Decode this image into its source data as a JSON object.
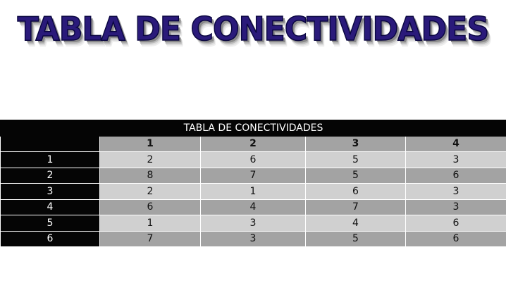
{
  "heading": "TABLA DE CONECTIVIDADES",
  "table": {
    "caption": "TABLA DE CONECTIVIDADES",
    "columns": [
      "1",
      "2",
      "3",
      "4"
    ],
    "rows": [
      {
        "label": "1",
        "values": [
          "2",
          "6",
          "5",
          "3"
        ]
      },
      {
        "label": "2",
        "values": [
          "8",
          "7",
          "5",
          "6"
        ]
      },
      {
        "label": "3",
        "values": [
          "2",
          "1",
          "6",
          "3"
        ]
      },
      {
        "label": "4",
        "values": [
          "6",
          "4",
          "7",
          "3"
        ]
      },
      {
        "label": "5",
        "values": [
          "1",
          "3",
          "4",
          "6"
        ]
      },
      {
        "label": "6",
        "values": [
          "7",
          "3",
          "5",
          "6"
        ]
      }
    ]
  },
  "colors": {
    "heading": "#2a1a7a",
    "header_background": "#050505",
    "light_row": "#d0d0d0",
    "dark_row": "#a3a3a3"
  }
}
